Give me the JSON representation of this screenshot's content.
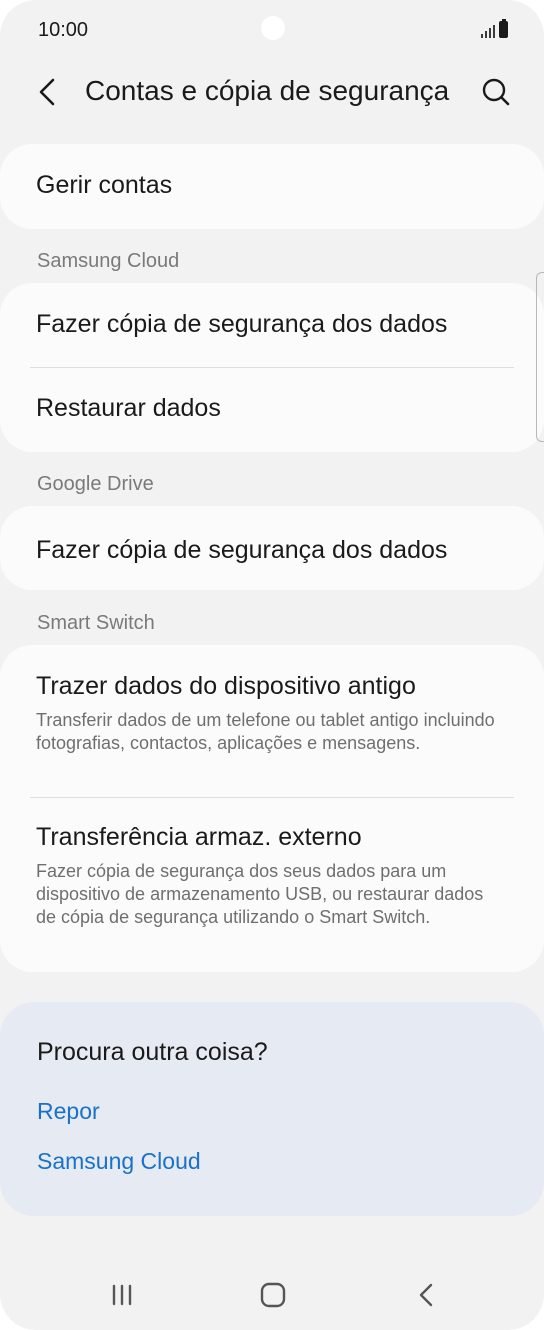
{
  "status": {
    "time": "10:00"
  },
  "appbar": {
    "title": "Contas e cópia de segurança"
  },
  "items": {
    "manage_accounts": "Gerir contas",
    "samsung_cloud_header": "Samsung Cloud",
    "samsung_backup": "Fazer cópia de segurança dos dados",
    "samsung_restore": "Restaurar dados",
    "google_drive_header": "Google Drive",
    "google_backup": "Fazer cópia de segurança dos dados",
    "smart_switch_header": "Smart Switch",
    "bring_data_title": "Trazer dados do dispositivo antigo",
    "bring_data_sub": "Transferir dados de um telefone ou tablet antigo incluindo fotografias, contactos, aplicações e mensagens.",
    "external_title": "Transferência armaz. externo",
    "external_sub": "Fazer cópia de segurança dos seus dados para um dispositivo de armazenamento USB, ou restaurar dados de cópia de segurança utilizando o Smart Switch."
  },
  "suggest": {
    "title": "Procura outra coisa?",
    "links": [
      "Repor",
      "Samsung Cloud"
    ]
  },
  "colors": {
    "link": "#1a72c8",
    "background": "#f2f2f2",
    "card": "#fbfbfb",
    "suggest_bg": "#e6eaf2"
  }
}
